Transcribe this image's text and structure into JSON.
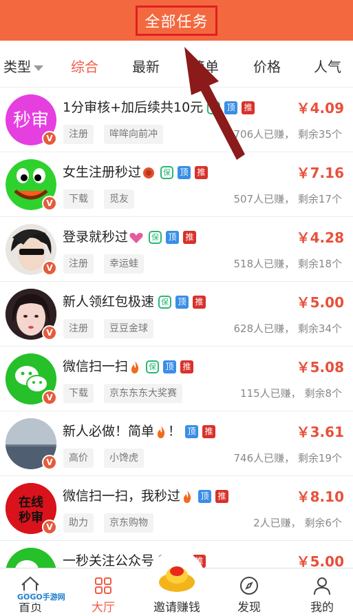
{
  "header": {
    "title": "全部任务"
  },
  "tabs": [
    {
      "label": "类型"
    },
    {
      "label": "综合"
    },
    {
      "label": "最新"
    },
    {
      "label": "简单"
    },
    {
      "label": "价格"
    },
    {
      "label": "人气"
    }
  ],
  "tasks": [
    {
      "title": "1分审核+加后续共10元",
      "price": "￥4.09",
      "tag1": "注册",
      "tag2": "哞哞向前冲",
      "stats": "706人已赚， 剩余35个",
      "avatar": "秒审"
    },
    {
      "title": "女生注册秒过",
      "price": "￥7.16",
      "tag1": "下载",
      "tag2": "觅友",
      "stats": "507人已赚， 剩余17个"
    },
    {
      "title": "登录就秒过",
      "price": "￥4.28",
      "tag1": "注册",
      "tag2": "幸运蛙",
      "stats": "518人已赚， 剩余18个"
    },
    {
      "title": "新人领红包极速",
      "price": "￥5.00",
      "tag1": "注册",
      "tag2": "豆豆金球",
      "stats": "628人已赚， 剩余34个"
    },
    {
      "title": "微信扫一扫",
      "price": "￥5.08",
      "tag1": "下载",
      "tag2": "京东东东大奖赛",
      "stats": "115人已赚， 剩余8个"
    },
    {
      "title": "新人必做！简单",
      "title_end": "！",
      "price": "￥3.61",
      "tag1": "高价",
      "tag2": "小馋虎",
      "stats": "746人已赚， 剩余19个"
    },
    {
      "title": "微信扫一扫，我秒过",
      "price": "￥8.10",
      "tag1": "助力",
      "tag2": "京东购物",
      "stats": "2人已赚， 剩余6个",
      "avatar_line1": "在线",
      "avatar_line2": "秒审"
    },
    {
      "title": "一秒关注公众号",
      "price": "￥5.00"
    }
  ],
  "badges": {
    "bao": "保",
    "ding": "顶",
    "tui": "推",
    "v": "V"
  },
  "nav": {
    "home": "首页",
    "hall": "大厅",
    "invite": "邀请赚钱",
    "discover": "发现",
    "mine": "我的"
  },
  "watermark": "GOGO手游网",
  "colors": {
    "header": "#f4683f",
    "accent": "#f25a45",
    "price": "#e8503a"
  }
}
